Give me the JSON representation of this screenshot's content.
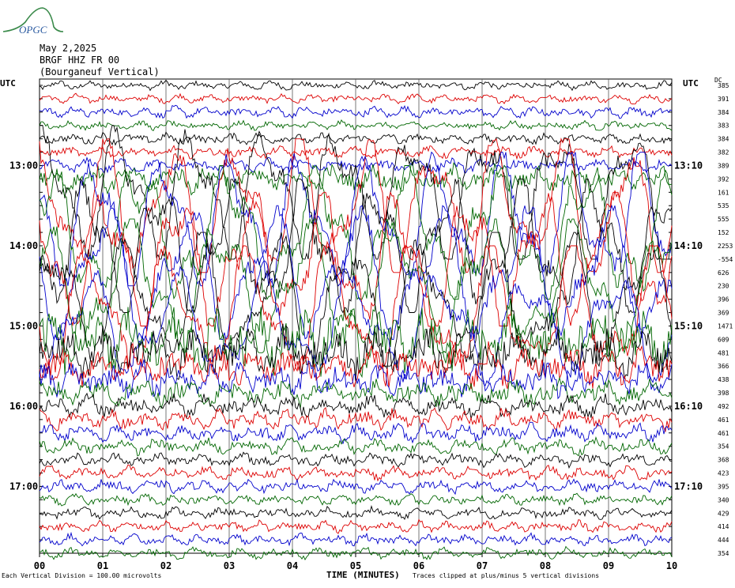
{
  "logo": {
    "text": "OPGC"
  },
  "header": {
    "date": "May 2,2025",
    "station": "BRGF HHZ FR 00",
    "site": "(Bourganeuf Vertical)",
    "utc_left": "UTC",
    "utc_right": "UTC",
    "dc_label": "DC"
  },
  "chart_data": {
    "type": "line",
    "xlabel": "TIME (MINUTES)",
    "xlim": [
      0,
      10
    ],
    "x_ticks": [
      "00",
      "01",
      "02",
      "03",
      "04",
      "05",
      "06",
      "07",
      "08",
      "09",
      "10"
    ],
    "left_hour_labels": [
      {
        "row": 6,
        "label": "13:00"
      },
      {
        "row": 12,
        "label": "14:00"
      },
      {
        "row": 18,
        "label": "15:00"
      },
      {
        "row": 24,
        "label": "16:00"
      },
      {
        "row": 30,
        "label": "17:00"
      }
    ],
    "right_hour_labels": [
      {
        "row": 6,
        "label": "13:10"
      },
      {
        "row": 12,
        "label": "14:10"
      },
      {
        "row": 18,
        "label": "15:10"
      },
      {
        "row": 24,
        "label": "16:10"
      },
      {
        "row": 30,
        "label": "17:10"
      }
    ],
    "trace_colors": [
      "#000000",
      "#dd0000",
      "#0000cc",
      "#006600"
    ],
    "dc_offsets": [
      "385",
      "391",
      "384",
      "383",
      "384",
      "382",
      "389",
      "392",
      "161",
      "535",
      "555",
      "152",
      "2253",
      "-554",
      "626",
      "230",
      "396",
      "369",
      "1471",
      "609",
      "481",
      "366",
      "438",
      "398",
      "492",
      "461",
      "461",
      "354",
      "368",
      "423",
      "395",
      "340",
      "429",
      "414",
      "444",
      "354"
    ],
    "trace_amplitude_divisions": [
      0.4,
      0.4,
      0.5,
      0.4,
      0.5,
      0.5,
      0.6,
      1.2,
      5,
      5,
      5,
      5,
      5,
      5,
      5,
      5,
      5,
      5,
      4,
      3,
      2.2,
      1.8,
      1.5,
      1.2,
      1,
      0.9,
      0.8,
      0.7,
      0.6,
      0.6,
      0.6,
      0.5,
      0.5,
      0.5,
      0.5,
      0.5
    ],
    "notes": {
      "scale": "Each Vertical Division =  100.00 microvolts",
      "clip": "Traces clipped at plus/minus 5 vertical divisions"
    }
  }
}
